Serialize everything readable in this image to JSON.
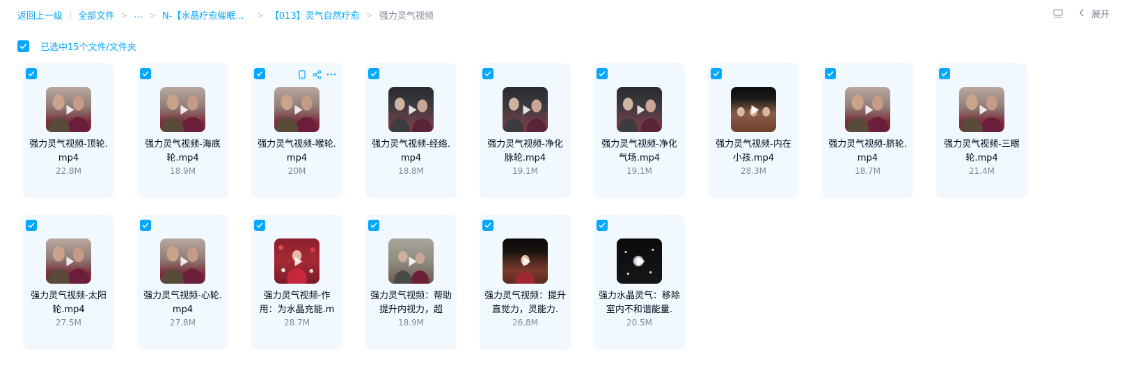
{
  "breadcrumb": {
    "back": "返回上一级",
    "all_files": "全部文件",
    "ellipsis": "...",
    "level1": "N-【水晶疗愈催眠...",
    "level2": "【013】灵气自然疗愈",
    "current": "强力灵气视频"
  },
  "toolbar": {
    "expand_label": "展开",
    "list_icon": "list-view-icon",
    "chevron_icon": "chevron-left-icon"
  },
  "selection": {
    "label": "已选中15个文件/文件夹",
    "checked": true
  },
  "colors": {
    "accent": "#06a7ff",
    "card_bg": "#f1f9ff",
    "muted": "#818999"
  },
  "files": [
    {
      "name": "强力灵气视频-顶轮.mp4",
      "size": "22.8M",
      "thumb": "t-couple"
    },
    {
      "name": "强力灵气视频-海底轮.mp4",
      "size": "18.9M",
      "thumb": "t-couple"
    },
    {
      "name": "强力灵气视频-喉轮.mp4",
      "size": "20M",
      "thumb": "t-couple"
    },
    {
      "name": "强力灵气视频-经络.mp4",
      "size": "18.8M",
      "thumb": "t-dark"
    },
    {
      "name": "强力灵气视频-净化脉轮.mp4",
      "size": "19.1M",
      "thumb": "t-dark"
    },
    {
      "name": "强力灵气视频-净化气场.mp4",
      "size": "19.1M",
      "thumb": "t-dark"
    },
    {
      "name": "强力灵气视频-内在小孩.mp4",
      "size": "28.3M",
      "thumb": "t-black"
    },
    {
      "name": "强力灵气视频-脐轮.mp4",
      "size": "18.7M",
      "thumb": "t-couple"
    },
    {
      "name": "强力灵气视频-三眼轮.mp4",
      "size": "21.4M",
      "thumb": "t-couple"
    },
    {
      "name": "强力灵气视频-太阳轮.mp4",
      "size": "27.5M",
      "thumb": "t-couple"
    },
    {
      "name": "强力灵气视频-心轮.mp4",
      "size": "27.8M",
      "thumb": "t-couple"
    },
    {
      "name": "强力灵气视频-作用：为水晶充能.m",
      "size": "28.7M",
      "thumb": "t-red"
    },
    {
      "name": "强力灵气视频：帮助提升内视力，超",
      "size": "18.9M",
      "thumb": "t-room"
    },
    {
      "name": "强力灵气视频：提升直觉力，灵能力.",
      "size": "26.8M",
      "thumb": "t-stage"
    },
    {
      "name": "强力水晶灵气：移除室内不和谐能量.",
      "size": "20.5M",
      "thumb": "t-crystal"
    }
  ],
  "hover_card_index": 2,
  "card_actions": [
    "phone-icon",
    "share-icon",
    "more-icon"
  ]
}
